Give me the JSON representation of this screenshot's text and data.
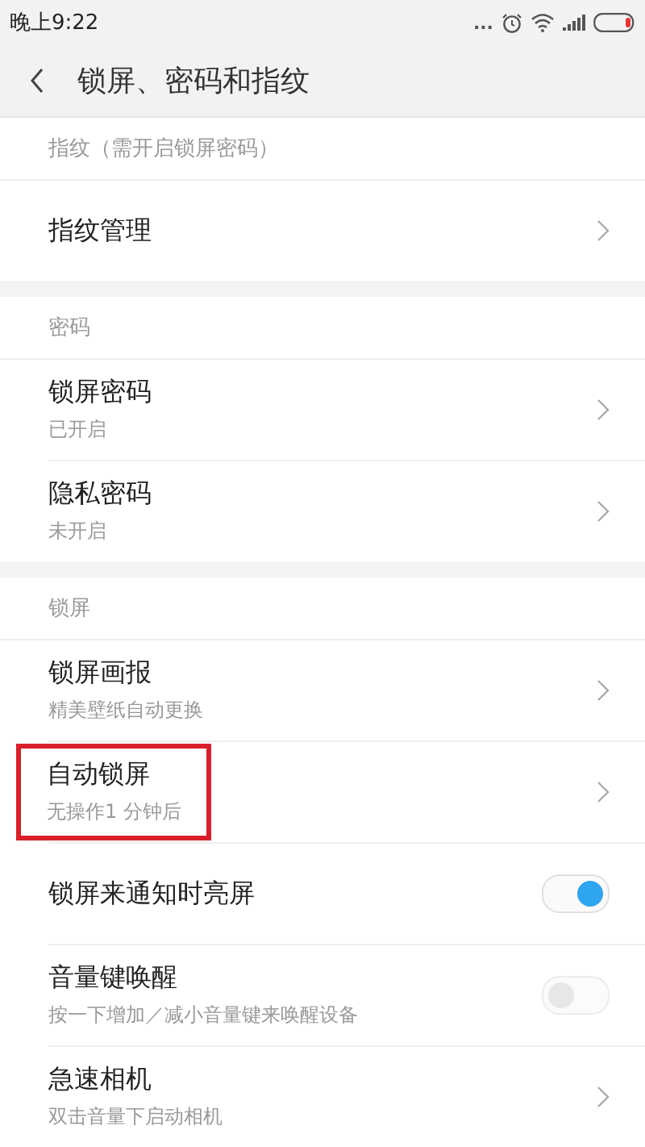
{
  "status_bar": {
    "time": "晚上9:22",
    "more": "..."
  },
  "header": {
    "title": "锁屏、密码和指纹"
  },
  "sections": [
    {
      "title": "指纹（需开启锁屏密码）",
      "items": [
        {
          "kind": "link",
          "label": "指纹管理",
          "highlighted": false
        }
      ]
    },
    {
      "title": "密码",
      "items": [
        {
          "kind": "link",
          "label": "锁屏密码",
          "subtitle": "已开启",
          "highlighted": false
        },
        {
          "kind": "link",
          "label": "隐私密码",
          "subtitle": "未开启",
          "highlighted": false
        }
      ]
    },
    {
      "title": "锁屏",
      "items": [
        {
          "kind": "link",
          "label": "锁屏画报",
          "subtitle": "精美壁纸自动更换",
          "highlighted": false
        },
        {
          "kind": "link",
          "label": "自动锁屏",
          "subtitle": "无操作1 分钟后",
          "highlighted": true
        },
        {
          "kind": "toggle",
          "label": "锁屏来通知时亮屏",
          "on": true,
          "disabled": false,
          "highlighted": false
        },
        {
          "kind": "toggle",
          "label": "音量键唤醒",
          "subtitle": "按一下增加／减小音量键来唤醒设备",
          "on": false,
          "disabled": true,
          "highlighted": false
        },
        {
          "kind": "link",
          "label": "急速相机",
          "subtitle": "双击音量下启动相机",
          "highlighted": false
        }
      ]
    }
  ]
}
